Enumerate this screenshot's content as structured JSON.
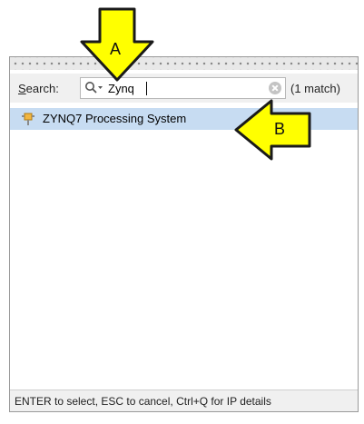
{
  "search": {
    "label_accel": "S",
    "label_rest": "earch:",
    "value": "Zynq",
    "match_count": "(1 match)"
  },
  "results": [
    {
      "label": "ZYNQ7 Processing System",
      "icon": "ip-core-icon"
    }
  ],
  "status": "ENTER to select, ESC to cancel, Ctrl+Q for IP details",
  "callouts": {
    "a": "A",
    "b": "B"
  },
  "colors": {
    "selection": "#c7dcf2",
    "callout_fill": "#ffff00",
    "panel_bg": "#f0f0f0"
  }
}
